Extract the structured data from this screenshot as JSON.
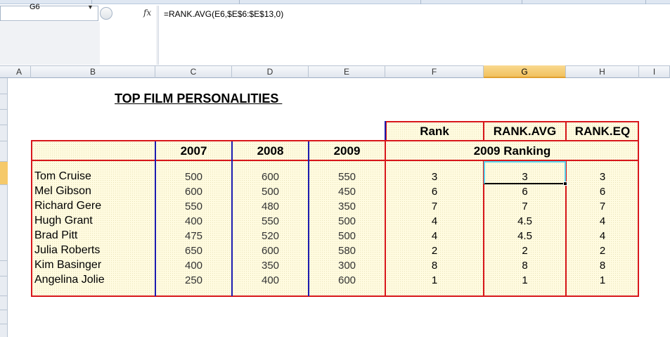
{
  "name_box": {
    "value": "G6"
  },
  "formula_bar": {
    "fx_label": "fx",
    "formula": "=RANK.AVG(E6,$E$6:$E$13,0)"
  },
  "columns": [
    "A",
    "B",
    "C",
    "D",
    "E",
    "F",
    "G",
    "H",
    "I"
  ],
  "sheet": {
    "title": "TOP FILM PERSONALITIES ",
    "rank_header": "Rank",
    "rank_avg_header": "RANK.AVG",
    "rank_eq_header": "RANK.EQ",
    "year_headers": [
      "2007",
      "2008",
      "2009"
    ],
    "ranking_header": "2009 Ranking",
    "rows": [
      {
        "name": "Tom Cruise",
        "y2007": "500",
        "y2008": "600",
        "y2009": "550",
        "rank": "3",
        "rank_avg": "3",
        "rank_eq": "3"
      },
      {
        "name": "Mel Gibson",
        "y2007": "600",
        "y2008": "500",
        "y2009": "450",
        "rank": "6",
        "rank_avg": "6",
        "rank_eq": "6"
      },
      {
        "name": "Richard Gere",
        "y2007": "550",
        "y2008": "480",
        "y2009": "350",
        "rank": "7",
        "rank_avg": "7",
        "rank_eq": "7"
      },
      {
        "name": "Hugh Grant",
        "y2007": "400",
        "y2008": "550",
        "y2009": "500",
        "rank": "4",
        "rank_avg": "4.5",
        "rank_eq": "4"
      },
      {
        "name": "Brad Pitt",
        "y2007": "475",
        "y2008": "520",
        "y2009": "500",
        "rank": "4",
        "rank_avg": "4.5",
        "rank_eq": "4"
      },
      {
        "name": "Julia Roberts",
        "y2007": "650",
        "y2008": "600",
        "y2009": "580",
        "rank": "2",
        "rank_avg": "2",
        "rank_eq": "2"
      },
      {
        "name": "Kim Basinger",
        "y2007": "400",
        "y2008": "350",
        "y2009": "300",
        "rank": "8",
        "rank_avg": "8",
        "rank_eq": "8"
      },
      {
        "name": "Angelina Jolie",
        "y2007": "250",
        "y2008": "400",
        "y2009": "600",
        "rank": "1",
        "rank_avg": "1",
        "rank_eq": "1"
      }
    ]
  }
}
